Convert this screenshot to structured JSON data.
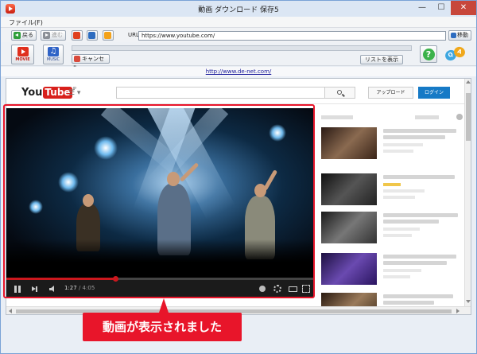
{
  "window": {
    "title": "動画 ダウンロード 保存5",
    "icon": "play-app-icon",
    "controls": {
      "minimize": "—",
      "maximize": "☐",
      "close": "✕"
    }
  },
  "menu": {
    "file": "ファイル(F)"
  },
  "nav": {
    "back_label": "戻る",
    "forward_label": "進む",
    "url_label": "URL:",
    "url_value": "https://www.youtube.com/",
    "go_label": "移動"
  },
  "toolbar": {
    "movie_label": "MOVIE",
    "music_label": "MUSIC",
    "music_glyph": "♫",
    "cancel_label": "キャンセル",
    "list_label": "リストを表示",
    "help_label": "?",
    "qa_q": "Q",
    "qa_a": "A"
  },
  "link_strip": {
    "text": "http://www.de-net.com/"
  },
  "youtube": {
    "logo_you": "You",
    "logo_tube": "Tube",
    "logo_region": "JP",
    "guide_icon": "☰ ▾",
    "upload_label": "アップロード",
    "login_label": "ログイン"
  },
  "player": {
    "current_time": "1:27",
    "duration": "4:05",
    "time_separator": " / ",
    "progress_fraction": 0.355
  },
  "annotation": {
    "callout_text": "動画が表示されました"
  },
  "colors": {
    "accent_red": "#e8152a",
    "youtube_red": "#d8201b",
    "login_blue": "#167ac6"
  }
}
